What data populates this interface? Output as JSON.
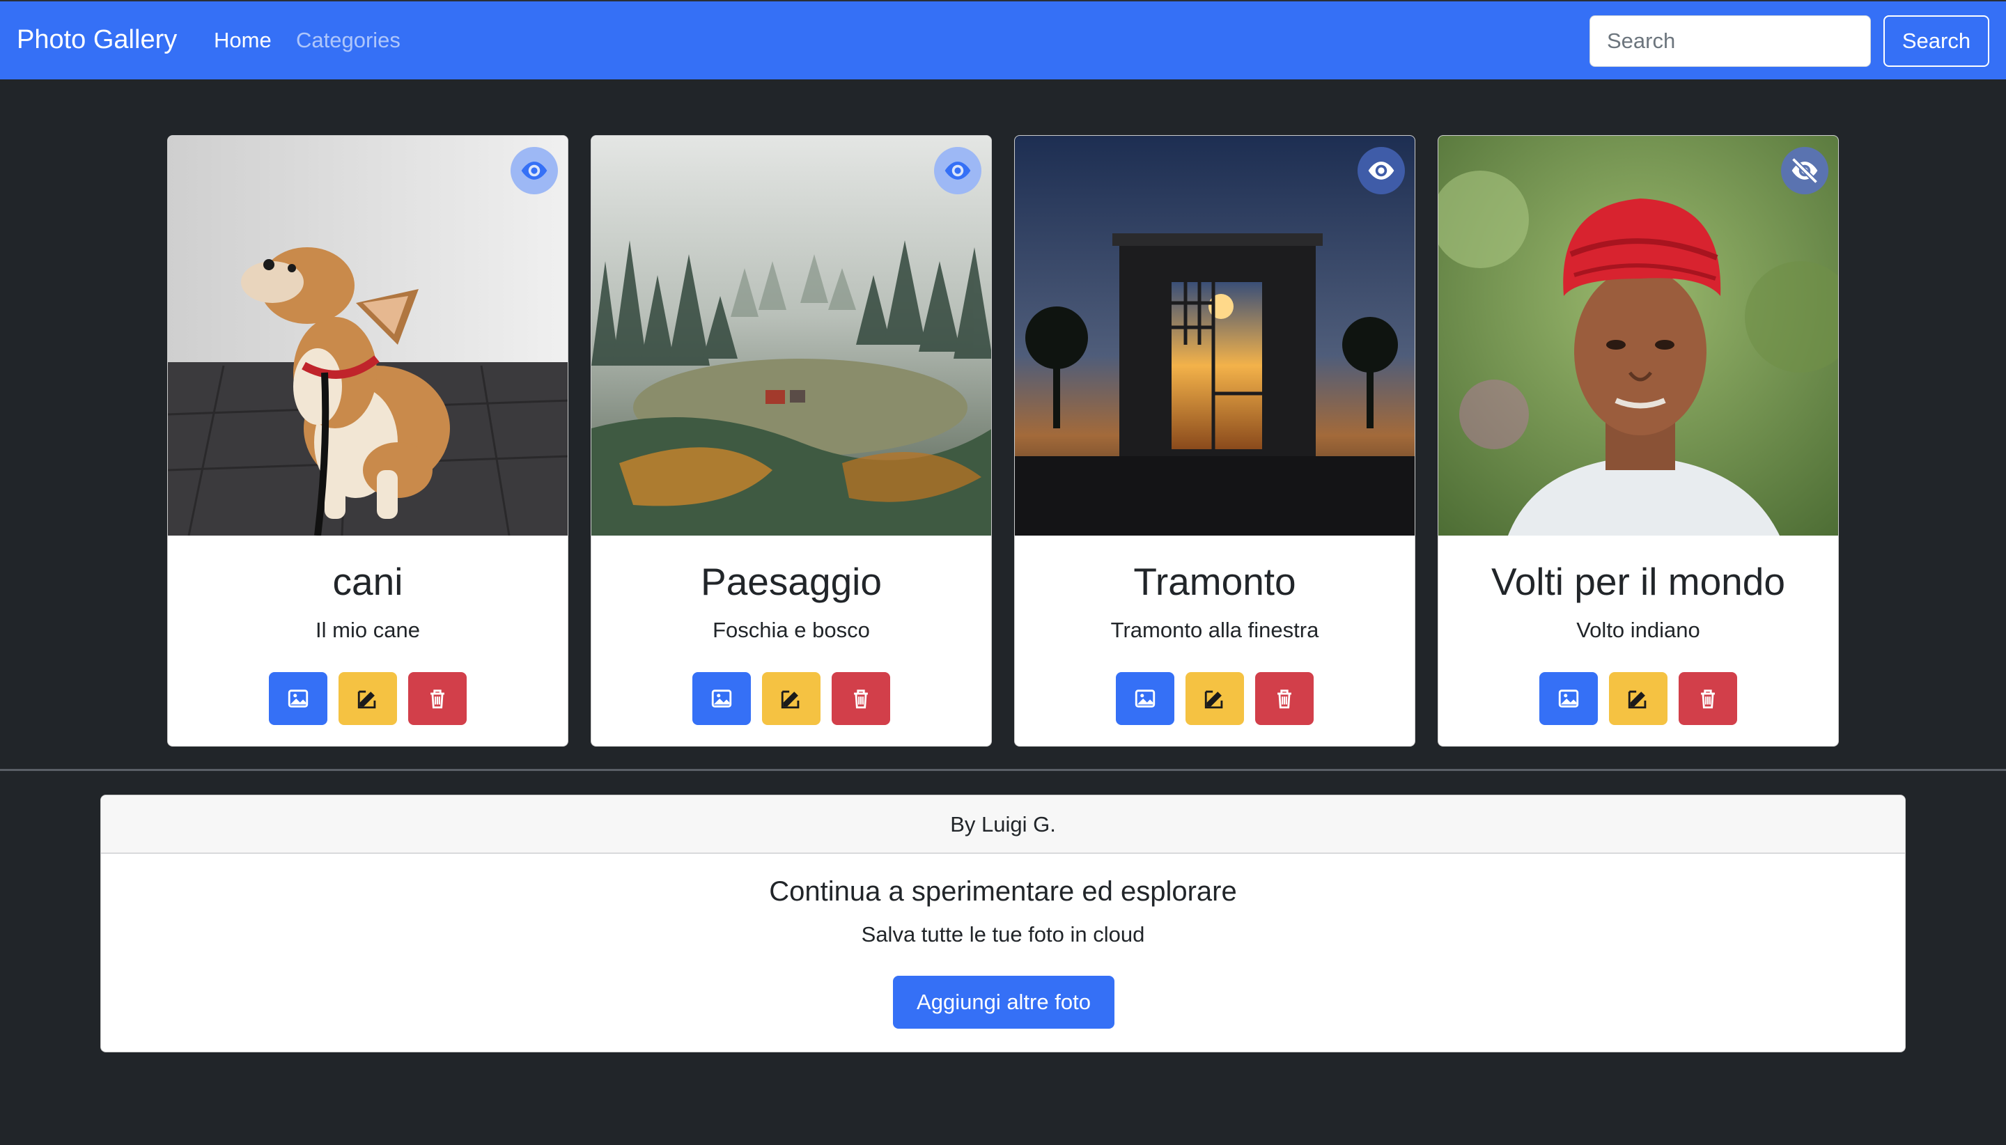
{
  "navbar": {
    "brand": "Photo Gallery",
    "links": [
      {
        "label": "Home",
        "active": true
      },
      {
        "label": "Categories",
        "active": false
      }
    ],
    "search_placeholder": "Search",
    "search_button": "Search"
  },
  "cards": [
    {
      "title": "cani",
      "description": "Il mio cane",
      "visibility_icon": "eye-icon",
      "image_subject": "dog"
    },
    {
      "title": "Paesaggio",
      "description": "Foschia e bosco",
      "visibility_icon": "eye-icon",
      "image_subject": "forest"
    },
    {
      "title": "Tramonto",
      "description": "Tramonto alla finestra",
      "visibility_icon": "eye-icon",
      "image_subject": "sunset"
    },
    {
      "title": "Volti per il mondo",
      "description": "Volto indiano",
      "visibility_icon": "eye-slash-icon",
      "image_subject": "portrait"
    }
  ],
  "card_actions": [
    "image-icon",
    "edit-icon",
    "trash-icon"
  ],
  "footer": {
    "header": "By Luigi G.",
    "title": "Continua a sperimentare ed esplorare",
    "text": "Salva tutte le tue foto in cloud",
    "button": "Aggiungi altre foto"
  },
  "colors": {
    "primary": "#3570f6",
    "warning": "#f5c242",
    "danger": "#d23f4a",
    "background": "#212529"
  }
}
